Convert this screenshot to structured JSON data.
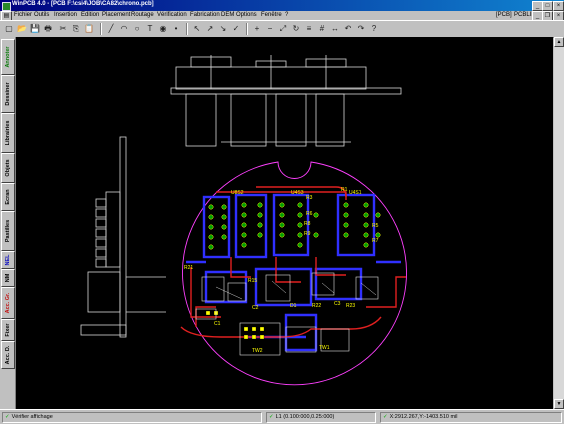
{
  "window": {
    "title": "WinPCB 4.0 - [PCB F:\\csi4\\JOB\\CA82\\chrono.pcb]",
    "controls": {
      "minimize": "_",
      "maximize": "□",
      "close": "×"
    }
  },
  "menu": {
    "items": [
      "Fichier",
      "Outils",
      "Insertion",
      "Edition",
      "Placement",
      "Routage",
      "Vérification",
      "Fabrication",
      "DEM",
      "Options",
      "Fenêtre",
      "?"
    ],
    "right_labels": [
      "[PCB]",
      "PCBLIB"
    ]
  },
  "toolbar": {
    "icons": [
      "new-icon",
      "open-icon",
      "save-icon",
      "print-icon",
      "cut-icon",
      "copy-icon",
      "paste-icon",
      "line-icon",
      "arc-icon",
      "circle-icon",
      "text-icon",
      "pad-icon",
      "via-icon",
      "select-icon",
      "route-icon",
      "unroute-icon",
      "drc-icon",
      "zoom-in-icon",
      "zoom-out-icon",
      "zoom-fit-icon",
      "redraw-icon",
      "layer-icon",
      "grid-icon",
      "measure-icon",
      "undo-icon",
      "redo-icon",
      "help-icon"
    ],
    "glyphs": [
      "▢",
      "📂",
      "💾",
      "🖶",
      "✂",
      "⎘",
      "📋",
      "╱",
      "◠",
      "○",
      "T",
      "◉",
      "•",
      "↖",
      "↗",
      "↘",
      "✓",
      "+",
      "−",
      "⤢",
      "↻",
      "≡",
      "#",
      "↔",
      "↶",
      "↷",
      "?"
    ]
  },
  "sidebar": {
    "tabs": [
      {
        "label": "Annoter",
        "color": "#0a7a0a"
      },
      {
        "label": "Dessiner",
        "color": "#000000"
      },
      {
        "label": "Librairies",
        "color": "#000000"
      },
      {
        "label": "Objets",
        "color": "#000000"
      },
      {
        "label": "Ecran",
        "color": "#000000"
      },
      {
        "label": "Pastilles",
        "color": "#000000"
      },
      {
        "label": "NEL",
        "color": "#1010c0"
      },
      {
        "label": "NM",
        "color": "#000000"
      },
      {
        "label": "Acc. Gr.",
        "color": "#c01010"
      },
      {
        "label": "Fixer",
        "color": "#000000"
      },
      {
        "label": "Acc. D.",
        "color": "#000000"
      }
    ]
  },
  "board": {
    "components": [
      "U8S2",
      "U4S3",
      "U4S1",
      "R1",
      "R3",
      "R5",
      "R6",
      "R7",
      "R8",
      "R9",
      "R15",
      "R21",
      "R22",
      "R23",
      "C1",
      "C2",
      "C3",
      "D1",
      "TW1",
      "TW2"
    ]
  },
  "status": {
    "message": "Vérifier affichage",
    "layer_info": "L1 (0.100:000,0.25:000)",
    "coords": "X:2912.267,Y:-1403.510 mil"
  },
  "colors": {
    "outline": "#ff40ff",
    "mech": "#d8d8d8",
    "copper_top": "#e02020",
    "copper_bottom": "#3030ff",
    "pads": "#00a000",
    "silk": "#ffff00"
  }
}
